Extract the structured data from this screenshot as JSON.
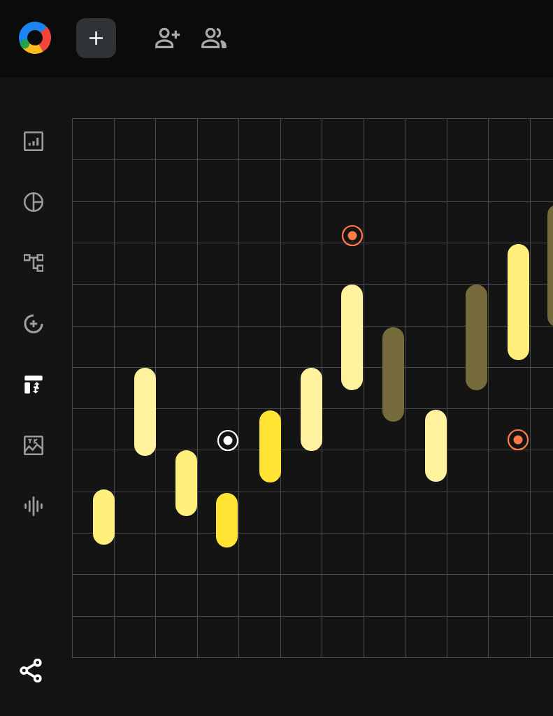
{
  "sidebar": {
    "items": [
      {
        "selected": false
      },
      {
        "selected": false
      },
      {
        "selected": false
      },
      {
        "selected": false
      },
      {
        "selected": true
      },
      {
        "selected": false
      },
      {
        "selected": false
      }
    ]
  },
  "canvas": {
    "notes": [
      {
        "color": "#fff07c"
      },
      {
        "color": "#fff29e"
      },
      {
        "color": "#fff07c"
      },
      {
        "color": "#ffe433"
      },
      {
        "color": "#ffe433"
      },
      {
        "color": "#fff29e"
      },
      {
        "color": "#fff29e"
      },
      {
        "color": "#766b3b"
      },
      {
        "color": "#fff29e"
      },
      {
        "color": "#766b3b"
      },
      {
        "color": "#fff07c"
      },
      {
        "color": "#766b3b"
      }
    ],
    "markers": [
      {
        "color": "#ff7b45"
      },
      {
        "color": "#ffffff"
      },
      {
        "color": "#ff7b45"
      }
    ]
  }
}
